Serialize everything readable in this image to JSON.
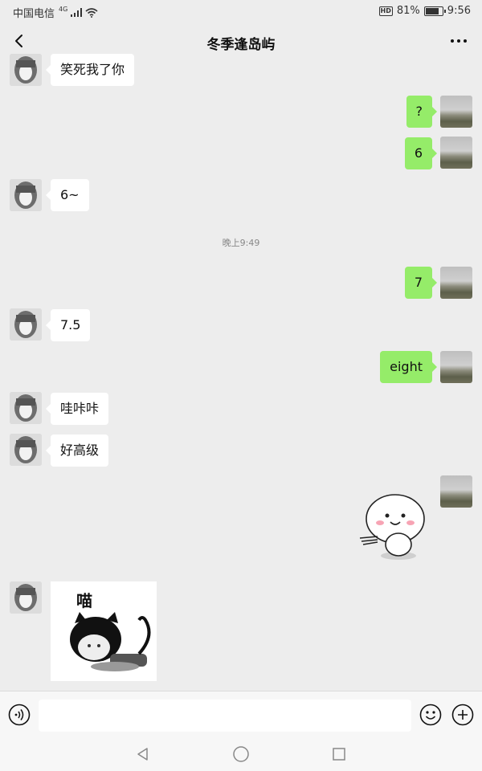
{
  "status_bar": {
    "carrier": "中国电信",
    "network": "4G",
    "hd": "HD",
    "battery": "81%",
    "battery_level": 0.81,
    "time": "9:56"
  },
  "header": {
    "title": "冬季逢岛屿"
  },
  "messages": [
    {
      "from": "other",
      "text": "笑死我了你"
    },
    {
      "from": "me",
      "text": "?"
    },
    {
      "from": "me",
      "text": "6"
    },
    {
      "from": "other",
      "text": "6~"
    },
    {
      "from": "me",
      "text": "7"
    },
    {
      "from": "other",
      "text": "7.5"
    },
    {
      "from": "me",
      "text": "eight"
    },
    {
      "from": "other",
      "text": "哇咔咔"
    },
    {
      "from": "other",
      "text": "好高级"
    }
  ],
  "timestamp": "晚上9:49",
  "sticker_meow": {
    "text": "喵"
  },
  "icons": {
    "back": "chevron-left-icon",
    "more": "more-dots-icon",
    "voice": "voice-icon",
    "emoji": "emoji-icon",
    "plus": "plus-circle-icon"
  },
  "colors": {
    "background": "#ededed",
    "my_bubble": "#95ec69",
    "other_bubble": "#ffffff"
  }
}
